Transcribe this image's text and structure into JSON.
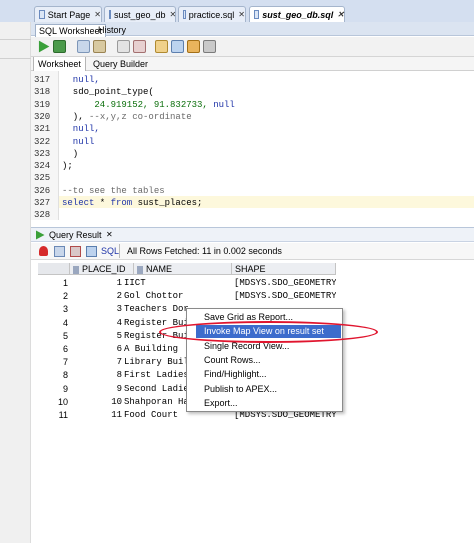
{
  "doc_tabs": [
    {
      "label": "Start Page",
      "close": "✕"
    },
    {
      "label": "sust_geo_db",
      "close": "✕"
    },
    {
      "label": "practice.sql",
      "close": "✕"
    },
    {
      "label": "sust_geo_db.sql",
      "close": "✕"
    }
  ],
  "sub_tabs": {
    "sql_worksheet": "SQL Worksheet",
    "history": "History"
  },
  "worksheet_tabs": {
    "worksheet": "Worksheet",
    "query_builder": "Query Builder"
  },
  "editor": {
    "lines": [
      {
        "n": "317",
        "segs": [
          {
            "t": "  null,",
            "c": "kw"
          }
        ]
      },
      {
        "n": "318",
        "segs": [
          {
            "t": "  sdo_point_type(",
            "c": ""
          }
        ]
      },
      {
        "n": "319",
        "segs": [
          {
            "t": "      24.919152, 91.832733, ",
            "c": "num"
          },
          {
            "t": "null",
            "c": "kw"
          }
        ]
      },
      {
        "n": "320",
        "segs": [
          {
            "t": "  ), ",
            "c": ""
          },
          {
            "t": "--x,y,z co-ordinate",
            "c": "cm"
          }
        ]
      },
      {
        "n": "321",
        "segs": [
          {
            "t": "  null,",
            "c": "kw"
          }
        ]
      },
      {
        "n": "322",
        "segs": [
          {
            "t": "  null",
            "c": "kw"
          }
        ]
      },
      {
        "n": "323",
        "segs": [
          {
            "t": "  )",
            "c": ""
          }
        ]
      },
      {
        "n": "324",
        "segs": [
          {
            "t": ");",
            "c": ""
          }
        ]
      },
      {
        "n": "325",
        "segs": []
      },
      {
        "n": "326",
        "segs": [
          {
            "t": "--to see the tables",
            "c": "cm"
          }
        ]
      },
      {
        "n": "327",
        "segs": [
          {
            "t": "select",
            "c": "kw"
          },
          {
            "t": " * ",
            "c": ""
          },
          {
            "t": "from",
            "c": "kw"
          },
          {
            "t": " sust_places;",
            "c": ""
          }
        ]
      },
      {
        "n": "328",
        "segs": []
      }
    ]
  },
  "query_result": {
    "tab_label": "Query Result",
    "close": "✕",
    "sql_label": "SQL",
    "status": "All Rows Fetched: 11 in 0.002 seconds",
    "columns": [
      "PLACE_ID",
      "NAME",
      "SHAPE"
    ],
    "rows": [
      {
        "n": "1",
        "id": "1",
        "name": "IICT",
        "shape": "[MDSYS.SDO_GEOMETRY]"
      },
      {
        "n": "2",
        "id": "2",
        "name": "Gol Chottor",
        "shape": "[MDSYS.SDO_GEOMETRY]"
      },
      {
        "n": "3",
        "id": "3",
        "name": "Teachers Dor",
        "shape": ""
      },
      {
        "n": "4",
        "id": "4",
        "name": "Register Bui",
        "shape": ""
      },
      {
        "n": "5",
        "id": "5",
        "name": "Register Bui",
        "shape": ""
      },
      {
        "n": "6",
        "id": "6",
        "name": "A Building",
        "shape": ""
      },
      {
        "n": "7",
        "id": "7",
        "name": "Library Buil",
        "shape": ""
      },
      {
        "n": "8",
        "id": "8",
        "name": "First Ladies",
        "shape": ""
      },
      {
        "n": "9",
        "id": "9",
        "name": "Second Ladie",
        "shape": ""
      },
      {
        "n": "10",
        "id": "10",
        "name": "Shahporan Hall",
        "shape": "[MDSYS.SDO_GEOMETRY]"
      },
      {
        "n": "11",
        "id": "11",
        "name": "Food Court",
        "shape": "[MDSYS.SDO_GEOMETRY]"
      }
    ]
  },
  "context_menu": {
    "items": [
      "Save Grid as Report...",
      "Invoke Map View on result set",
      "Single Record View...",
      "Count Rows...",
      "Find/Highlight...",
      "Publish to APEX...",
      "Export..."
    ],
    "selected_index": 1
  },
  "colors": {
    "accent": "#3c6ccc",
    "annotation": "#e0152e"
  }
}
